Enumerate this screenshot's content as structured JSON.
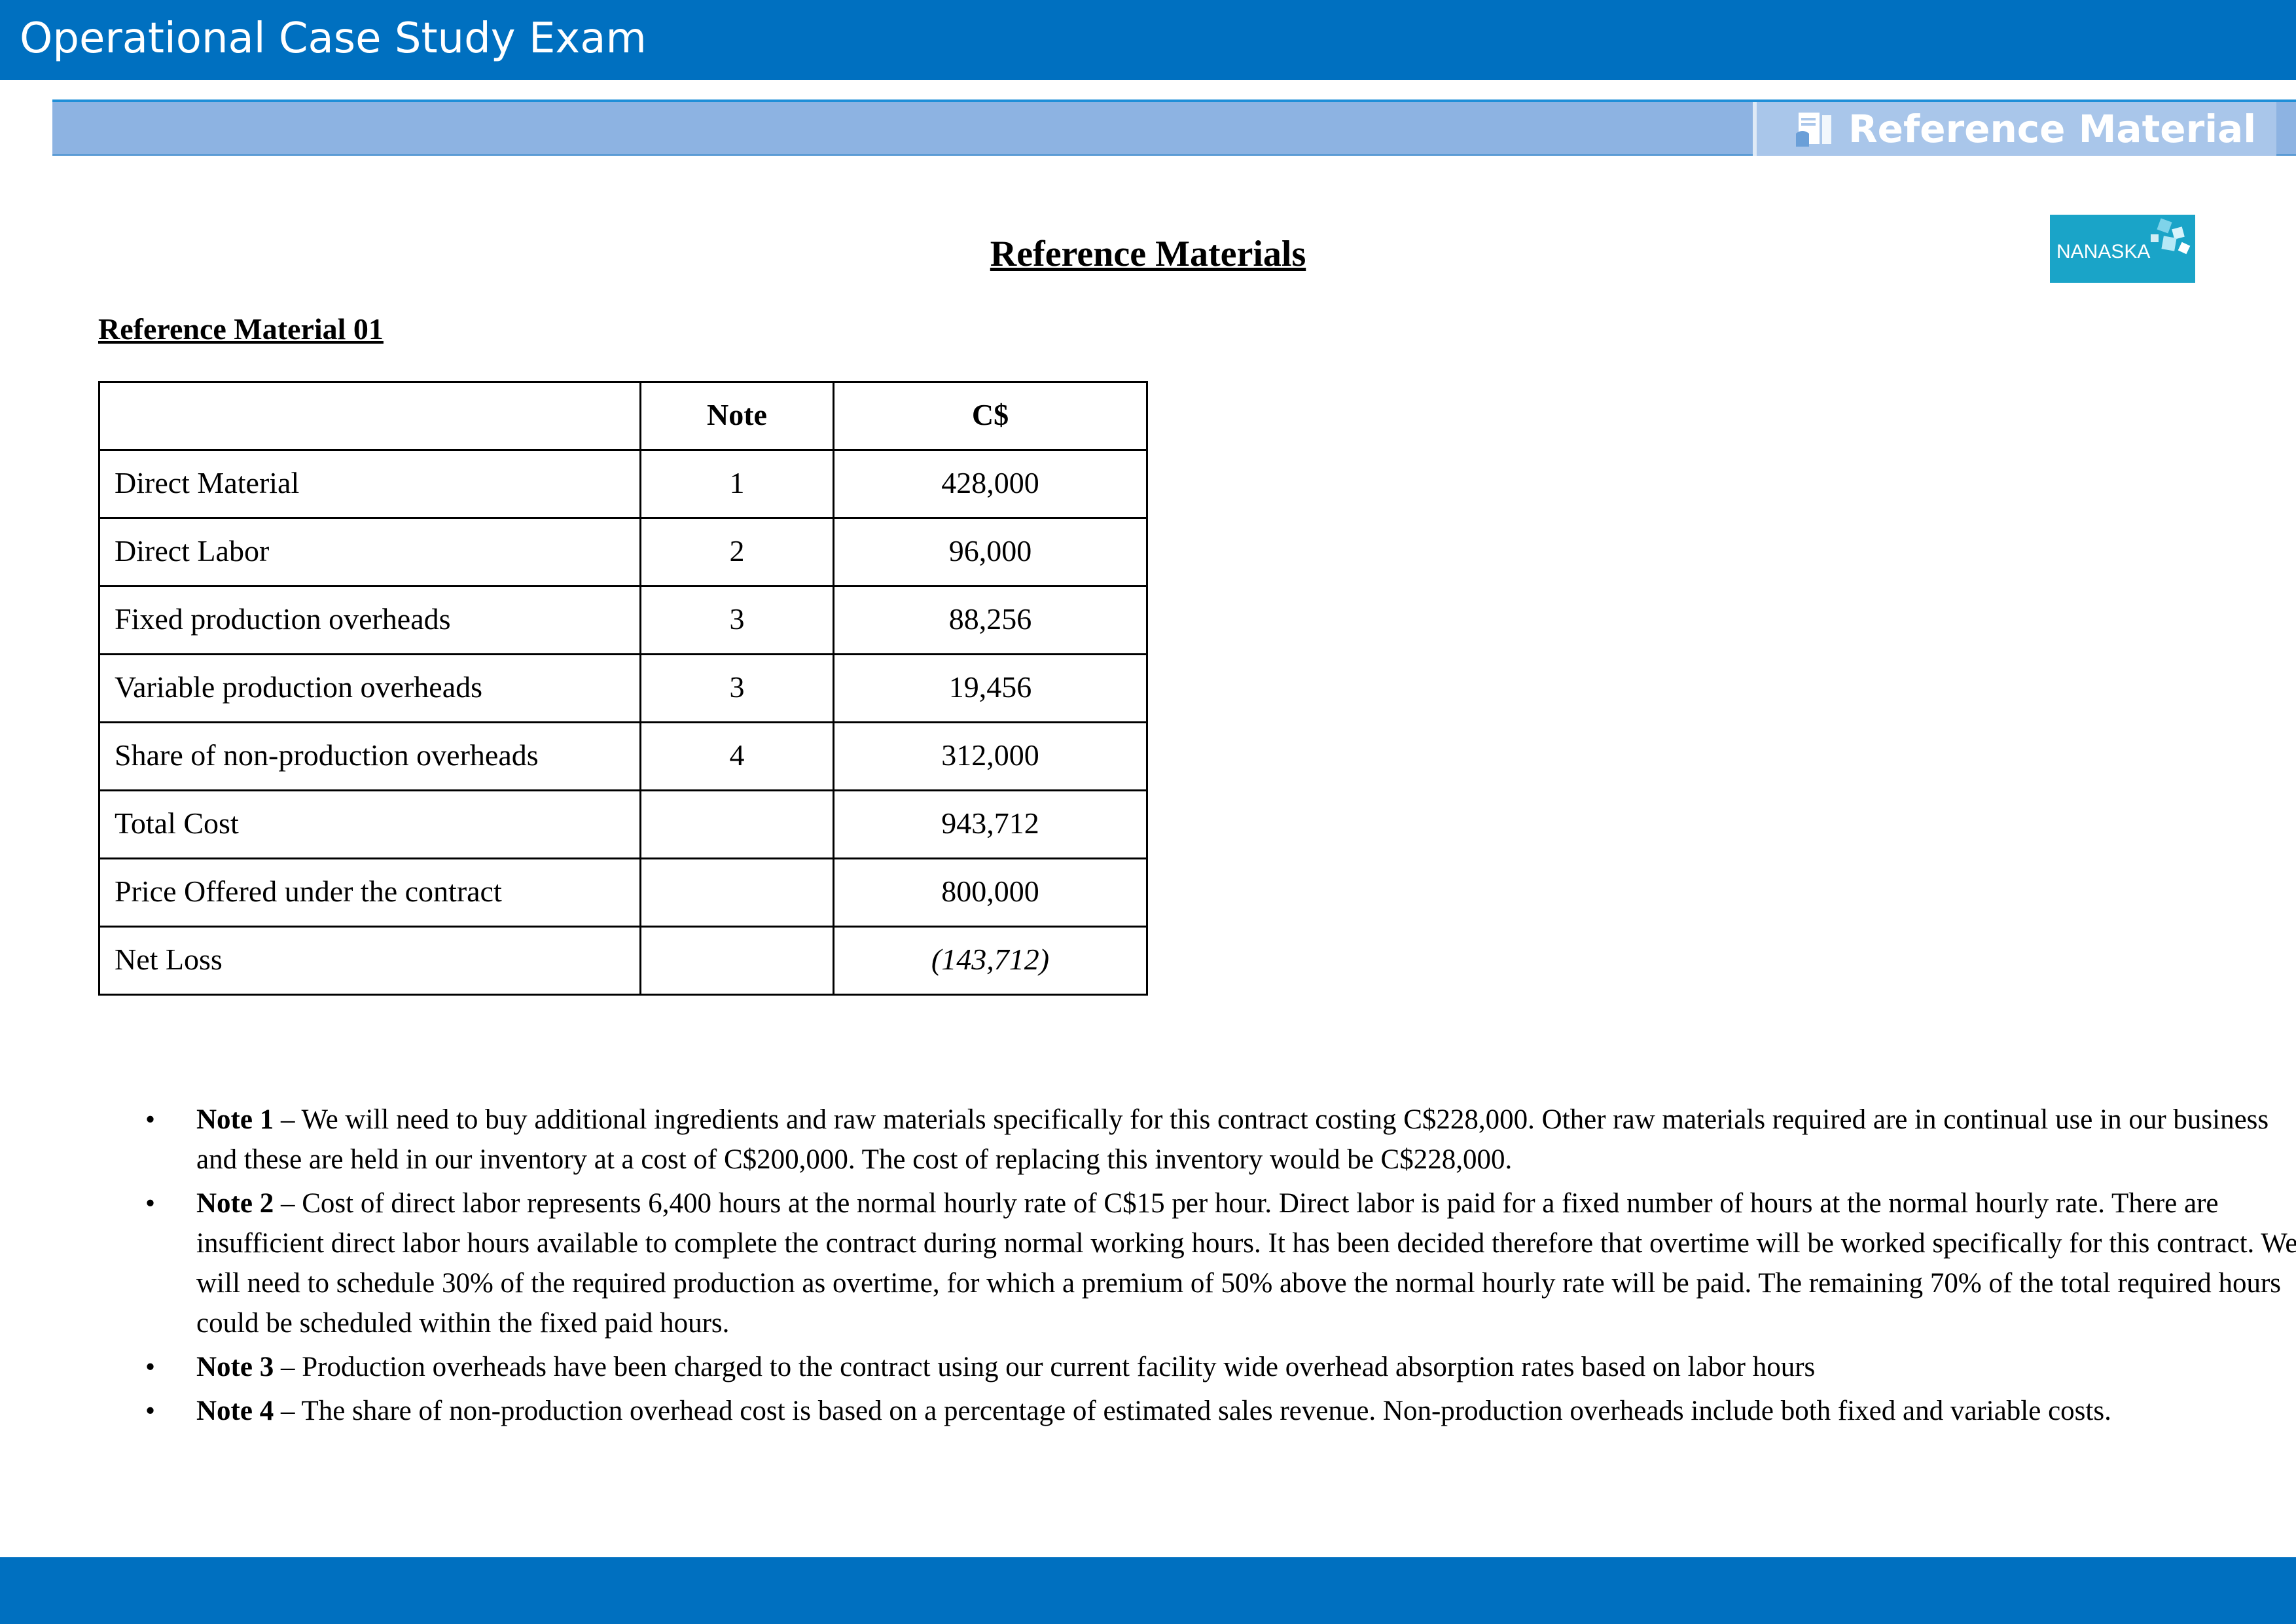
{
  "header": {
    "title": "Operational Case Study Exam",
    "section_tab_label": "Reference Material",
    "section_tab_icon": "document-reader-icon",
    "banner_color": "#0070c0",
    "subbar_color": "#8db3e2"
  },
  "logo": {
    "text": "NANASKA",
    "color": "#1aa4c8"
  },
  "page": {
    "heading": "Reference Materials",
    "section_heading": "Reference Material 01"
  },
  "table": {
    "headers": [
      "",
      "Note",
      "C$"
    ],
    "rows": [
      {
        "item": "Direct Material",
        "note": "1",
        "amount": "428,000"
      },
      {
        "item": "Direct Labor",
        "note": "2",
        "amount": "96,000"
      },
      {
        "item": "Fixed production overheads",
        "note": "3",
        "amount": "88,256"
      },
      {
        "item": "Variable production overheads",
        "note": "3",
        "amount": "19,456"
      },
      {
        "item": "Share of non-production overheads",
        "note": "4",
        "amount": "312,000"
      },
      {
        "item": "Total Cost",
        "note": "",
        "amount": "943,712"
      },
      {
        "item": "Price Offered under the contract",
        "note": "",
        "amount": "800,000"
      },
      {
        "item": "Net Loss",
        "note": "",
        "amount": "(143,712)"
      }
    ]
  },
  "notes": [
    {
      "label": "Note 1",
      "text": " – We will need to buy additional ingredients and raw materials specifically for this contract costing C$228,000. Other raw materials required are in continual use in our business and these are held in our inventory at a cost of C$200,000. The cost of replacing this inventory would be C$228,000."
    },
    {
      "label": "Note 2",
      "text": " – Cost of direct labor represents 6,400 hours at the normal hourly rate of C$15 per hour. Direct labor is paid for a fixed number of hours at the normal hourly rate. There are insufficient direct labor hours available to complete the contract during normal working hours. It has been decided therefore that overtime will be worked specifically for this contract. We will need to schedule 30% of the required production as overtime, for which a premium of 50% above the normal hourly rate will be paid. The remaining 70% of the total required hours could be scheduled within the fixed paid hours."
    },
    {
      "label": "Note 3",
      "text": " – Production overheads have been charged to the contract using our current facility wide overhead absorption rates based on labor hours"
    },
    {
      "label": "Note 4",
      "text": " – The share of non-production overhead cost is based on a percentage of estimated sales revenue. Non-production overheads include both fixed and variable costs."
    }
  ]
}
